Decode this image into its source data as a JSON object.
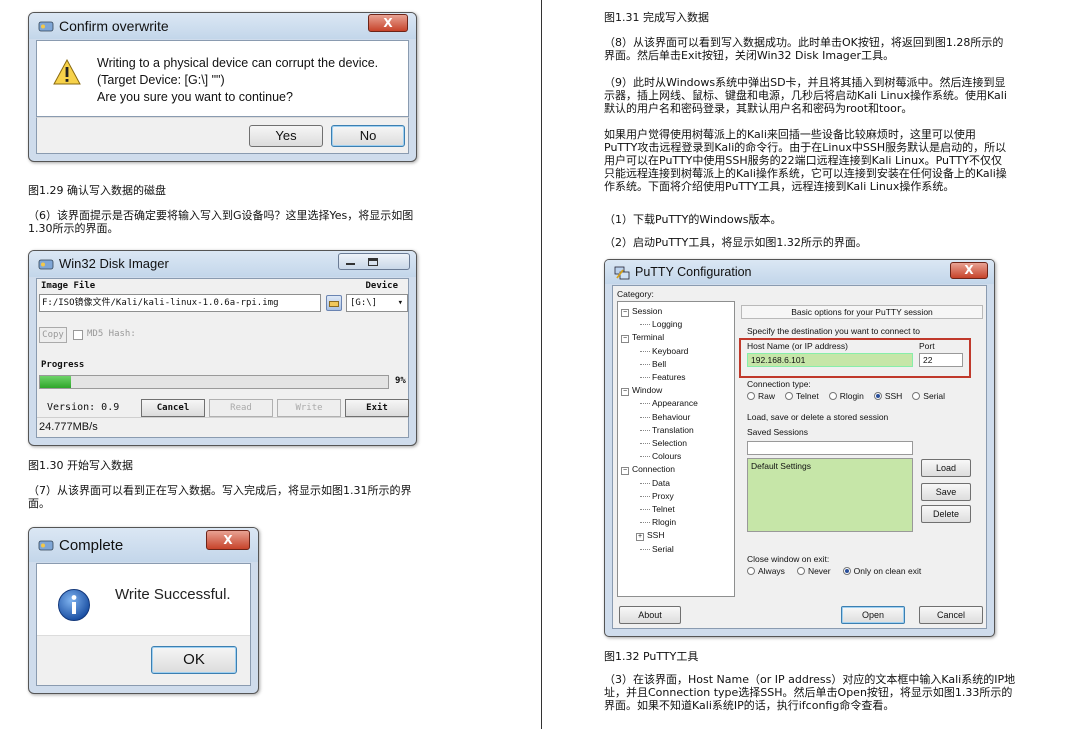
{
  "left": {
    "confirm_dialog": {
      "title": "Confirm overwrite",
      "close_glyph": "X",
      "message_line1": "Writing to a physical device can corrupt the device.",
      "message_line2": "(Target Device: [G:\\] \"\")",
      "message_line3": "Are you sure you want to continue?",
      "yes_label": "Yes",
      "no_label": "No",
      "icon": "warning-icon"
    },
    "caption_129": "图1.29 确认写入数据的磁盘",
    "para6_line1": "（6）该界面提示是否确定要将输入写入到G设备吗？这里选择Yes，将显示如图",
    "para6_line2": "1.30所示的界面。",
    "imager": {
      "title": "Win32 Disk Imager",
      "image_file_label": "Image File",
      "device_label": "Device",
      "image_path": "F:/ISO镜像文件/Kali/kali-linux-1.0.6a-rpi.img",
      "device_value": "[G:\\]",
      "copy_label": "Copy",
      "md5_label": "MD5 Hash:",
      "progress_label": "Progress",
      "progress_percent": "9%",
      "progress_value": 9,
      "version_label": "Version: 0.9",
      "cancel_label": "Cancel",
      "read_label": "Read",
      "write_label": "Write",
      "exit_label": "Exit",
      "speed": "24.777MB/s"
    },
    "caption_130": "图1.30 开始写入数据",
    "para7_line1": "（7）从该界面可以看到正在写入数据。写入完成后，将显示如图1.31所示的界",
    "para7_line2": "面。",
    "complete_dialog": {
      "title": "Complete",
      "close_glyph": "X",
      "message": "Write Successful.",
      "ok_label": "OK",
      "icon": "info-icon"
    }
  },
  "right": {
    "caption_131": "图1.31 完成写入数据",
    "para8_line1": "（8）从该界面可以看到写入数据成功。此时单击OK按钮，将返回到图1.28所示的",
    "para8_line2": "界面。然后单击Exit按钮，关闭Win32 Disk Imager工具。",
    "para9_line1": "（9）此时从Windows系统中弹出SD卡，并且将其插入到树莓派中。然后连接到显",
    "para9_line2": "示器，插上网线、鼠标、键盘和电源，几秒后将启动Kali Linux操作系统。使用Kali",
    "para9_line3": "默认的用户名和密码登录，其默认用户名和密码为root和toor。",
    "para10_line1": "如果用户觉得使用树莓派上的Kali来回插一些设备比较麻烦时，这里可以使用",
    "para10_line2": "PuTTY攻击远程登录到Kali的命令行。由于在Linux中SSH服务默认是启动的，所以",
    "para10_line3": "用户可以在PuTTY中使用SSH服务的22端口远程连接到Kali Linux。PuTTY不仅仅",
    "para10_line4": "只能远程连接到树莓派上的Kali操作系统，它可以连接到安装在任何设备上的Kali操",
    "para10_line5": "作系统。下面将介绍使用PuTTY工具，远程连接到Kali Linux操作系统。",
    "step1": "（1）下载PuTTY的Windows版本。",
    "step2": "（2）启动PuTTY工具，将显示如图1.32所示的界面。",
    "putty": {
      "title": "PuTTY Configuration",
      "close_glyph": "X",
      "category_label": "Category:",
      "tree": [
        "Session",
        "Logging",
        "Terminal",
        "Keyboard",
        "Bell",
        "Features",
        "Window",
        "Appearance",
        "Behaviour",
        "Translation",
        "Selection",
        "Colours",
        "Connection",
        "Data",
        "Proxy",
        "Telnet",
        "Rlogin",
        "SSH",
        "Serial"
      ],
      "panel_header": "Basic options for your PuTTY session",
      "dest_label": "Specify the destination you want to connect to",
      "host_label": "Host Name (or IP address)",
      "port_label": "Port",
      "host_value": "192.168.6.101",
      "port_value": "22",
      "conn_type_label": "Connection type:",
      "conn_types": [
        "Raw",
        "Telnet",
        "Rlogin",
        "SSH",
        "Serial"
      ],
      "conn_selected": "SSH",
      "load_save_label": "Load, save or delete a stored session",
      "saved_sessions_label": "Saved Sessions",
      "default_settings": "Default Settings",
      "load_label": "Load",
      "save_label": "Save",
      "delete_label": "Delete",
      "close_exit_label": "Close window on exit:",
      "close_options": [
        "Always",
        "Never",
        "Only on clean exit"
      ],
      "close_selected": "Only on clean exit",
      "about_label": "About",
      "open_label": "Open",
      "cancel_label": "Cancel",
      "highlight_color": "#c0392b"
    },
    "caption_132": "图1.32 PuTTY工具",
    "para3_line1": "（3）在该界面，Host Name（or IP address）对应的文本框中输入Kali系统的IP地",
    "para3_line2": "址，并且Connection type选择SSH。然后单击Open按钮，将显示如图1.33所示的",
    "para3_line3": "界面。如果不知道Kali系统IP的话，执行ifconfig命令查看。"
  }
}
